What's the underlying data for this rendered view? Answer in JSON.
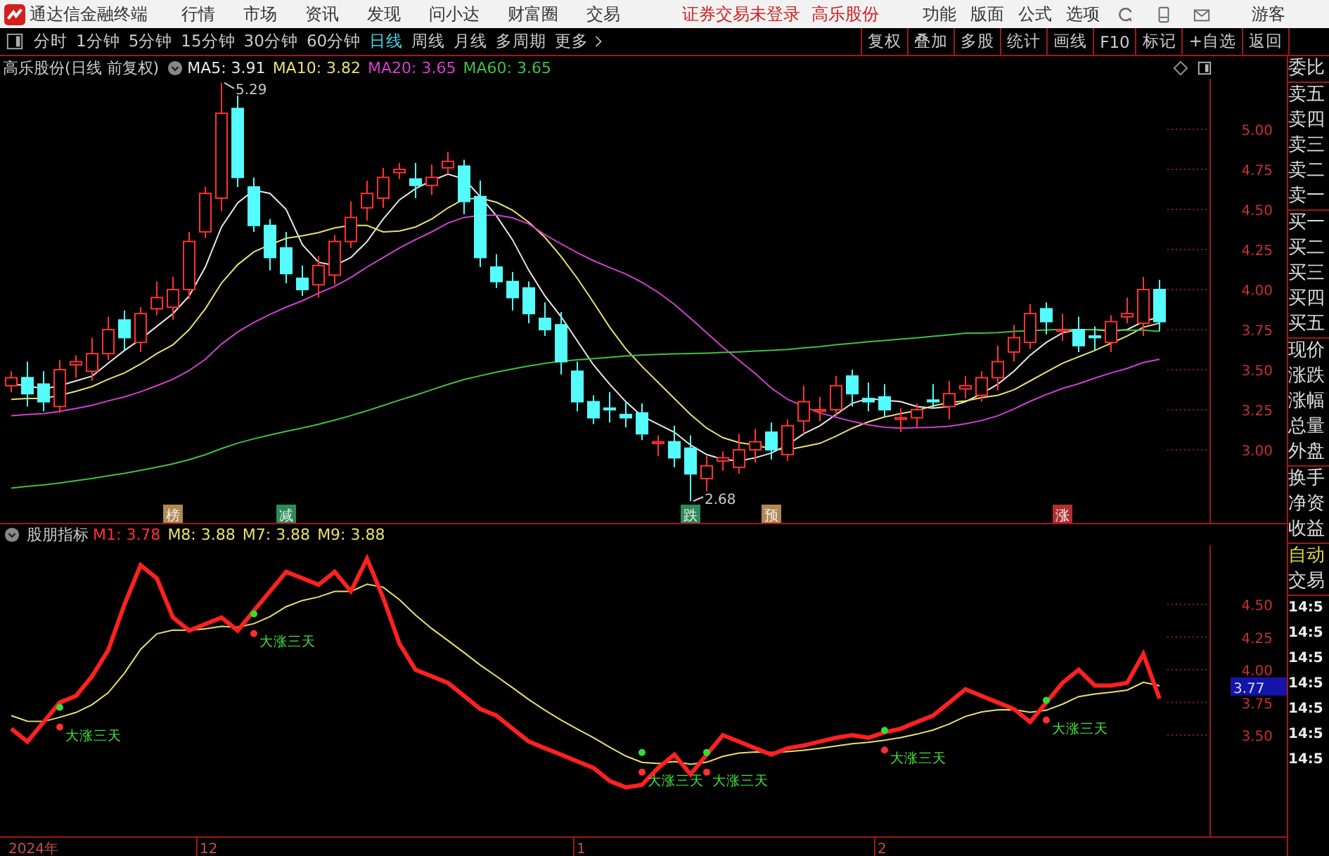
{
  "menu_bar": {
    "app_title": "通达信金融终端",
    "items": [
      "行情",
      "市场",
      "资讯",
      "发现",
      "问小达",
      "财富圈",
      "交易"
    ],
    "login_status": "证券交易未登录",
    "stock_name": "高乐股份",
    "right_items": [
      "功能",
      "版面",
      "公式",
      "选项"
    ],
    "user": "游客"
  },
  "toolbar": {
    "periods": [
      {
        "label": "分时",
        "selected": false
      },
      {
        "label": "1分钟",
        "selected": false
      },
      {
        "label": "5分钟",
        "selected": false
      },
      {
        "label": "15分钟",
        "selected": false
      },
      {
        "label": "30分钟",
        "selected": false
      },
      {
        "label": "60分钟",
        "selected": false
      },
      {
        "label": "日线",
        "selected": true
      },
      {
        "label": "周线",
        "selected": false
      },
      {
        "label": "月线",
        "selected": false
      },
      {
        "label": "多周期",
        "selected": false
      },
      {
        "label": "更多",
        "selected": false
      }
    ],
    "actions": [
      "复权",
      "叠加",
      "多股",
      "统计",
      "画线",
      "F10",
      "标记",
      "+自选",
      "返回"
    ]
  },
  "price_chart": {
    "title": "高乐股份(日线 前复权)",
    "legend": [
      {
        "text": "MA5: 3.91",
        "color": "#e8e8e8"
      },
      {
        "text": "MA10: 3.82",
        "color": "#e8e070"
      },
      {
        "text": "MA20: 3.65",
        "color": "#d040d0"
      },
      {
        "text": "MA60: 3.65",
        "color": "#40c040"
      }
    ],
    "y_axis": [
      "5.00",
      "4.75",
      "4.50",
      "4.25",
      "4.00",
      "3.75",
      "3.50",
      "3.25",
      "3.00"
    ],
    "high_label": "5.29",
    "low_label": "2.68",
    "markers": [
      {
        "text": "榜",
        "color": "#b08850"
      },
      {
        "text": "减",
        "color": "#2e8b57"
      },
      {
        "text": "跌",
        "color": "#2e8b57"
      },
      {
        "text": "预",
        "color": "#b08850"
      },
      {
        "text": "涨",
        "color": "#b03030"
      }
    ]
  },
  "indicator_chart": {
    "title": "股朋指标",
    "legend": [
      {
        "text": "M1: 3.78",
        "color": "#ff3030"
      },
      {
        "text": "M8: 3.88",
        "color": "#e8e070"
      },
      {
        "text": "M7: 3.88",
        "color": "#e8e070"
      },
      {
        "text": "M9: 3.88",
        "color": "#e8e070"
      }
    ],
    "y_axis": [
      "4.50",
      "4.25",
      "4.00",
      "3.75",
      "3.50"
    ],
    "current_value": "3.77",
    "signals": [
      {
        "label": "大涨三天"
      },
      {
        "label": "大涨三天"
      },
      {
        "label": "大涨三天"
      },
      {
        "label": "大涨三天"
      },
      {
        "label": "大涨三天"
      },
      {
        "label": "大涨三天"
      }
    ]
  },
  "date_axis": [
    "2024年",
    "12",
    "1",
    "2"
  ],
  "quote_panel": {
    "groups": [
      [
        "委比"
      ],
      [
        "卖五",
        "卖四",
        "卖三",
        "卖二",
        "卖一"
      ],
      [
        "买一",
        "买二",
        "买三",
        "买四",
        "买五"
      ],
      [
        "现价",
        "涨跌",
        "涨幅",
        "总量",
        "外盘"
      ],
      [
        "换手",
        "净资",
        "收益"
      ]
    ],
    "auto": "自动",
    "trade": "交易",
    "times": [
      "14:5",
      "14:5",
      "14:5",
      "14:5",
      "14:5",
      "14:5",
      "14:5"
    ]
  }
}
